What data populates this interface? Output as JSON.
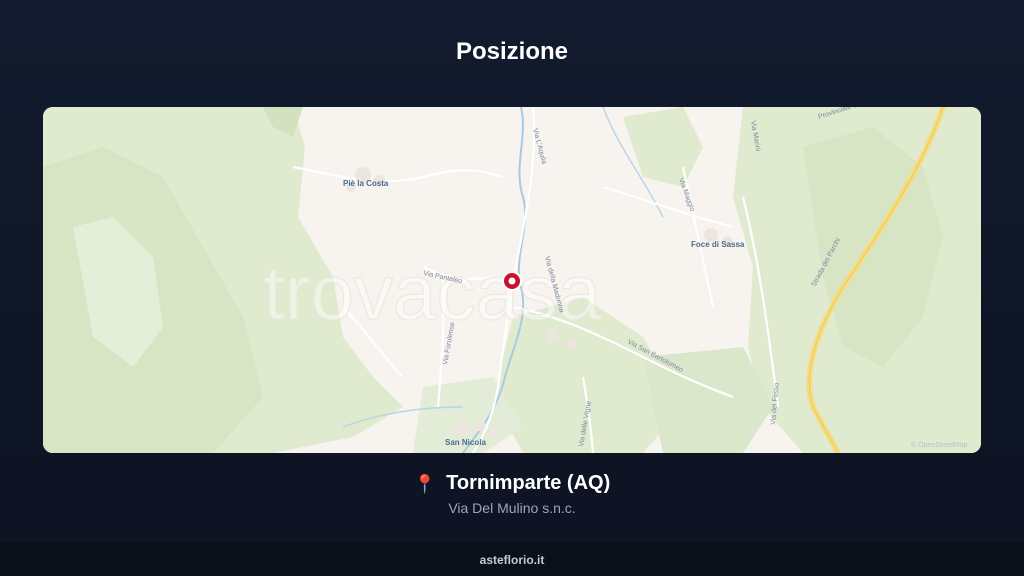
{
  "page": {
    "title": "Posizione"
  },
  "map": {
    "watermark": "trovacasa",
    "attribution": "© OpenStreetMap",
    "marker_icon": "location-marker",
    "colors": {
      "land": "#f7f3ee",
      "forest": "#dfeacf",
      "highway": "#f5dd83",
      "water": "#a7cbe3",
      "marker": "#c8102e"
    },
    "places": [
      "Piè la Costa",
      "Foce di Sassa",
      "San Nicola"
    ],
    "streets": [
      "Via Pantaleo",
      "Via Forulense",
      "Via L'Aquila",
      "Via della Madonna",
      "Via San Bartolomeo",
      "Via delle Vigne",
      "Via del Fosso",
      "Via Marini",
      "Strada dei Parchi",
      "Provinciale di Silvaplana",
      "Via Maggio"
    ]
  },
  "location": {
    "pin_icon": "round-pushpin-icon",
    "city": "Tornimparte (AQ)",
    "address": "Via Del Mulino s.n.c."
  },
  "footer": {
    "site": "asteflorio.it"
  }
}
